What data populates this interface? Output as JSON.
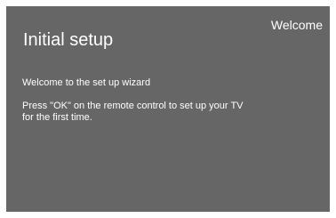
{
  "header": {
    "step_label": "Welcome",
    "title": "Initial setup"
  },
  "content": {
    "welcome_text": "Welcome to the set up wizard",
    "instruction_text": "Press \"OK\" on the remote control to set up your TV for the first time."
  },
  "colors": {
    "background": "#666666",
    "text": "#ffffff"
  }
}
